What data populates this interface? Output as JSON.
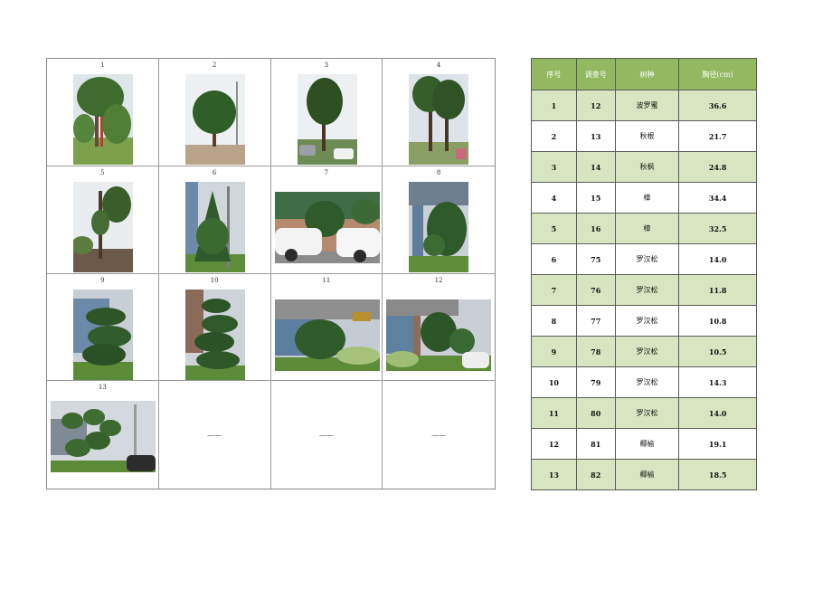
{
  "photos": [
    {
      "label": "1"
    },
    {
      "label": "2"
    },
    {
      "label": "3"
    },
    {
      "label": "4"
    },
    {
      "label": "5"
    },
    {
      "label": "6"
    },
    {
      "label": "7"
    },
    {
      "label": "8"
    },
    {
      "label": "9"
    },
    {
      "label": "10"
    },
    {
      "label": "11"
    },
    {
      "label": "12"
    },
    {
      "label": "13"
    },
    {
      "label": "——"
    },
    {
      "label": "——"
    },
    {
      "label": "——"
    }
  ],
  "table": {
    "headers": [
      "序号",
      "调查号",
      "树种",
      "胸径(cm)"
    ],
    "rows": [
      [
        "1",
        "12",
        "波罗蜜",
        "36.6"
      ],
      [
        "2",
        "13",
        "秋根",
        "21.7"
      ],
      [
        "3",
        "14",
        "秋枫",
        "24.8"
      ],
      [
        "4",
        "15",
        "樟",
        "34.4"
      ],
      [
        "5",
        "16",
        "樟",
        "32.5"
      ],
      [
        "6",
        "75",
        "罗汉松",
        "14.0"
      ],
      [
        "7",
        "76",
        "罗汉松",
        "11.8"
      ],
      [
        "8",
        "77",
        "罗汉松",
        "10.8"
      ],
      [
        "9",
        "78",
        "罗汉松",
        "10.5"
      ],
      [
        "10",
        "79",
        "罗汉松",
        "14.3"
      ],
      [
        "11",
        "80",
        "罗汉松",
        "14.0"
      ],
      [
        "12",
        "81",
        "椰榆",
        "19.1"
      ],
      [
        "13",
        "82",
        "椰榆",
        "18.5"
      ]
    ]
  },
  "colors": {
    "header_green": "#92b95f",
    "row_green": "#d7e6c0"
  }
}
